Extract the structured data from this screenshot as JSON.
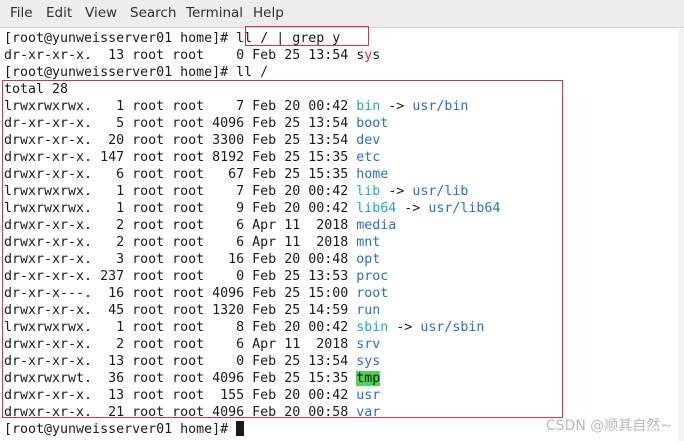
{
  "menu": [
    "File",
    "Edit",
    "View",
    "Search",
    "Terminal",
    "Help"
  ],
  "lines": [
    [
      {
        "t": "[root@yunweisserver01 home]# "
      },
      {
        "t": "ll / | grep y"
      }
    ],
    [
      {
        "t": "dr-xr-xr-x.  13 root root    0 Feb 25 13:54 "
      },
      {
        "t": "s",
        "c": "ydir"
      },
      {
        "t": "y",
        "c": "y-hl"
      },
      {
        "t": "s",
        "c": "ydir"
      }
    ],
    [
      {
        "t": "[root@yunweisserver01 home]# ll /"
      }
    ],
    [
      {
        "t": "total 28"
      }
    ],
    [
      {
        "t": "lrwxrwxrwx.   1 root root    7 Feb 20 00:42 "
      },
      {
        "t": "bin",
        "c": "link"
      },
      {
        "t": " -> ",
        "c": "arrow"
      },
      {
        "t": "usr/bin",
        "c": "dir"
      }
    ],
    [
      {
        "t": "dr-xr-xr-x.   5 root root 4096 Feb 25 13:54 "
      },
      {
        "t": "boot",
        "c": "dir"
      }
    ],
    [
      {
        "t": "drwxr-xr-x.  20 root root 3300 Feb 25 13:54 "
      },
      {
        "t": "dev",
        "c": "dir"
      }
    ],
    [
      {
        "t": "drwxr-xr-x. 147 root root 8192 Feb 25 15:35 "
      },
      {
        "t": "etc",
        "c": "dir"
      }
    ],
    [
      {
        "t": "drwxr-xr-x.   6 root root   67 Feb 25 15:35 "
      },
      {
        "t": "home",
        "c": "dir"
      }
    ],
    [
      {
        "t": "lrwxrwxrwx.   1 root root    7 Feb 20 00:42 "
      },
      {
        "t": "lib",
        "c": "link"
      },
      {
        "t": " -> ",
        "c": "arrow"
      },
      {
        "t": "usr/lib",
        "c": "dir"
      }
    ],
    [
      {
        "t": "lrwxrwxrwx.   1 root root    9 Feb 20 00:42 "
      },
      {
        "t": "lib64",
        "c": "link"
      },
      {
        "t": " -> ",
        "c": "arrow"
      },
      {
        "t": "usr/lib64",
        "c": "dir"
      }
    ],
    [
      {
        "t": "drwxr-xr-x.   2 root root    6 Apr 11  2018 "
      },
      {
        "t": "media",
        "c": "dir"
      }
    ],
    [
      {
        "t": "drwxr-xr-x.   2 root root    6 Apr 11  2018 "
      },
      {
        "t": "mnt",
        "c": "dir"
      }
    ],
    [
      {
        "t": "drwxr-xr-x.   3 root root   16 Feb 20 00:48 "
      },
      {
        "t": "opt",
        "c": "dir"
      }
    ],
    [
      {
        "t": "dr-xr-xr-x. 237 root root    0 Feb 25 13:53 "
      },
      {
        "t": "proc",
        "c": "dir"
      }
    ],
    [
      {
        "t": "dr-xr-x---.  16 root root 4096 Feb 25 15:00 "
      },
      {
        "t": "root",
        "c": "dir"
      }
    ],
    [
      {
        "t": "drwxr-xr-x.  45 root root 1320 Feb 25 14:59 "
      },
      {
        "t": "run",
        "c": "dir"
      }
    ],
    [
      {
        "t": "lrwxrwxrwx.   1 root root    8 Feb 20 00:42 "
      },
      {
        "t": "sbin",
        "c": "link"
      },
      {
        "t": " -> ",
        "c": "arrow"
      },
      {
        "t": "usr/sbin",
        "c": "dir"
      }
    ],
    [
      {
        "t": "drwxr-xr-x.   2 root root    6 Apr 11  2018 "
      },
      {
        "t": "srv",
        "c": "dir"
      }
    ],
    [
      {
        "t": "dr-xr-xr-x.  13 root root    0 Feb 25 13:54 "
      },
      {
        "t": "sys",
        "c": "dir"
      }
    ],
    [
      {
        "t": "drwxrwxrwt.  36 root root 4096 Feb 25 15:35 "
      },
      {
        "t": "tmp",
        "c": "tmp-hl"
      }
    ],
    [
      {
        "t": "drwxr-xr-x.  13 root root  155 Feb 20 00:42 "
      },
      {
        "t": "usr",
        "c": "dir"
      }
    ],
    [
      {
        "t": "drwxr-xr-x.  21 root root 4096 Feb 20 00:58 "
      },
      {
        "t": "var",
        "c": "dir"
      }
    ],
    [
      {
        "t": "[root@yunweisserver01 home]# "
      }
    ]
  ],
  "watermark": "CSDN @顺其自然~",
  "colors": {
    "dir": "#2f6fbd",
    "link": "#1fa9c6",
    "highlight_box": "#d9343b",
    "tmp_bg": "#4fd15b"
  }
}
